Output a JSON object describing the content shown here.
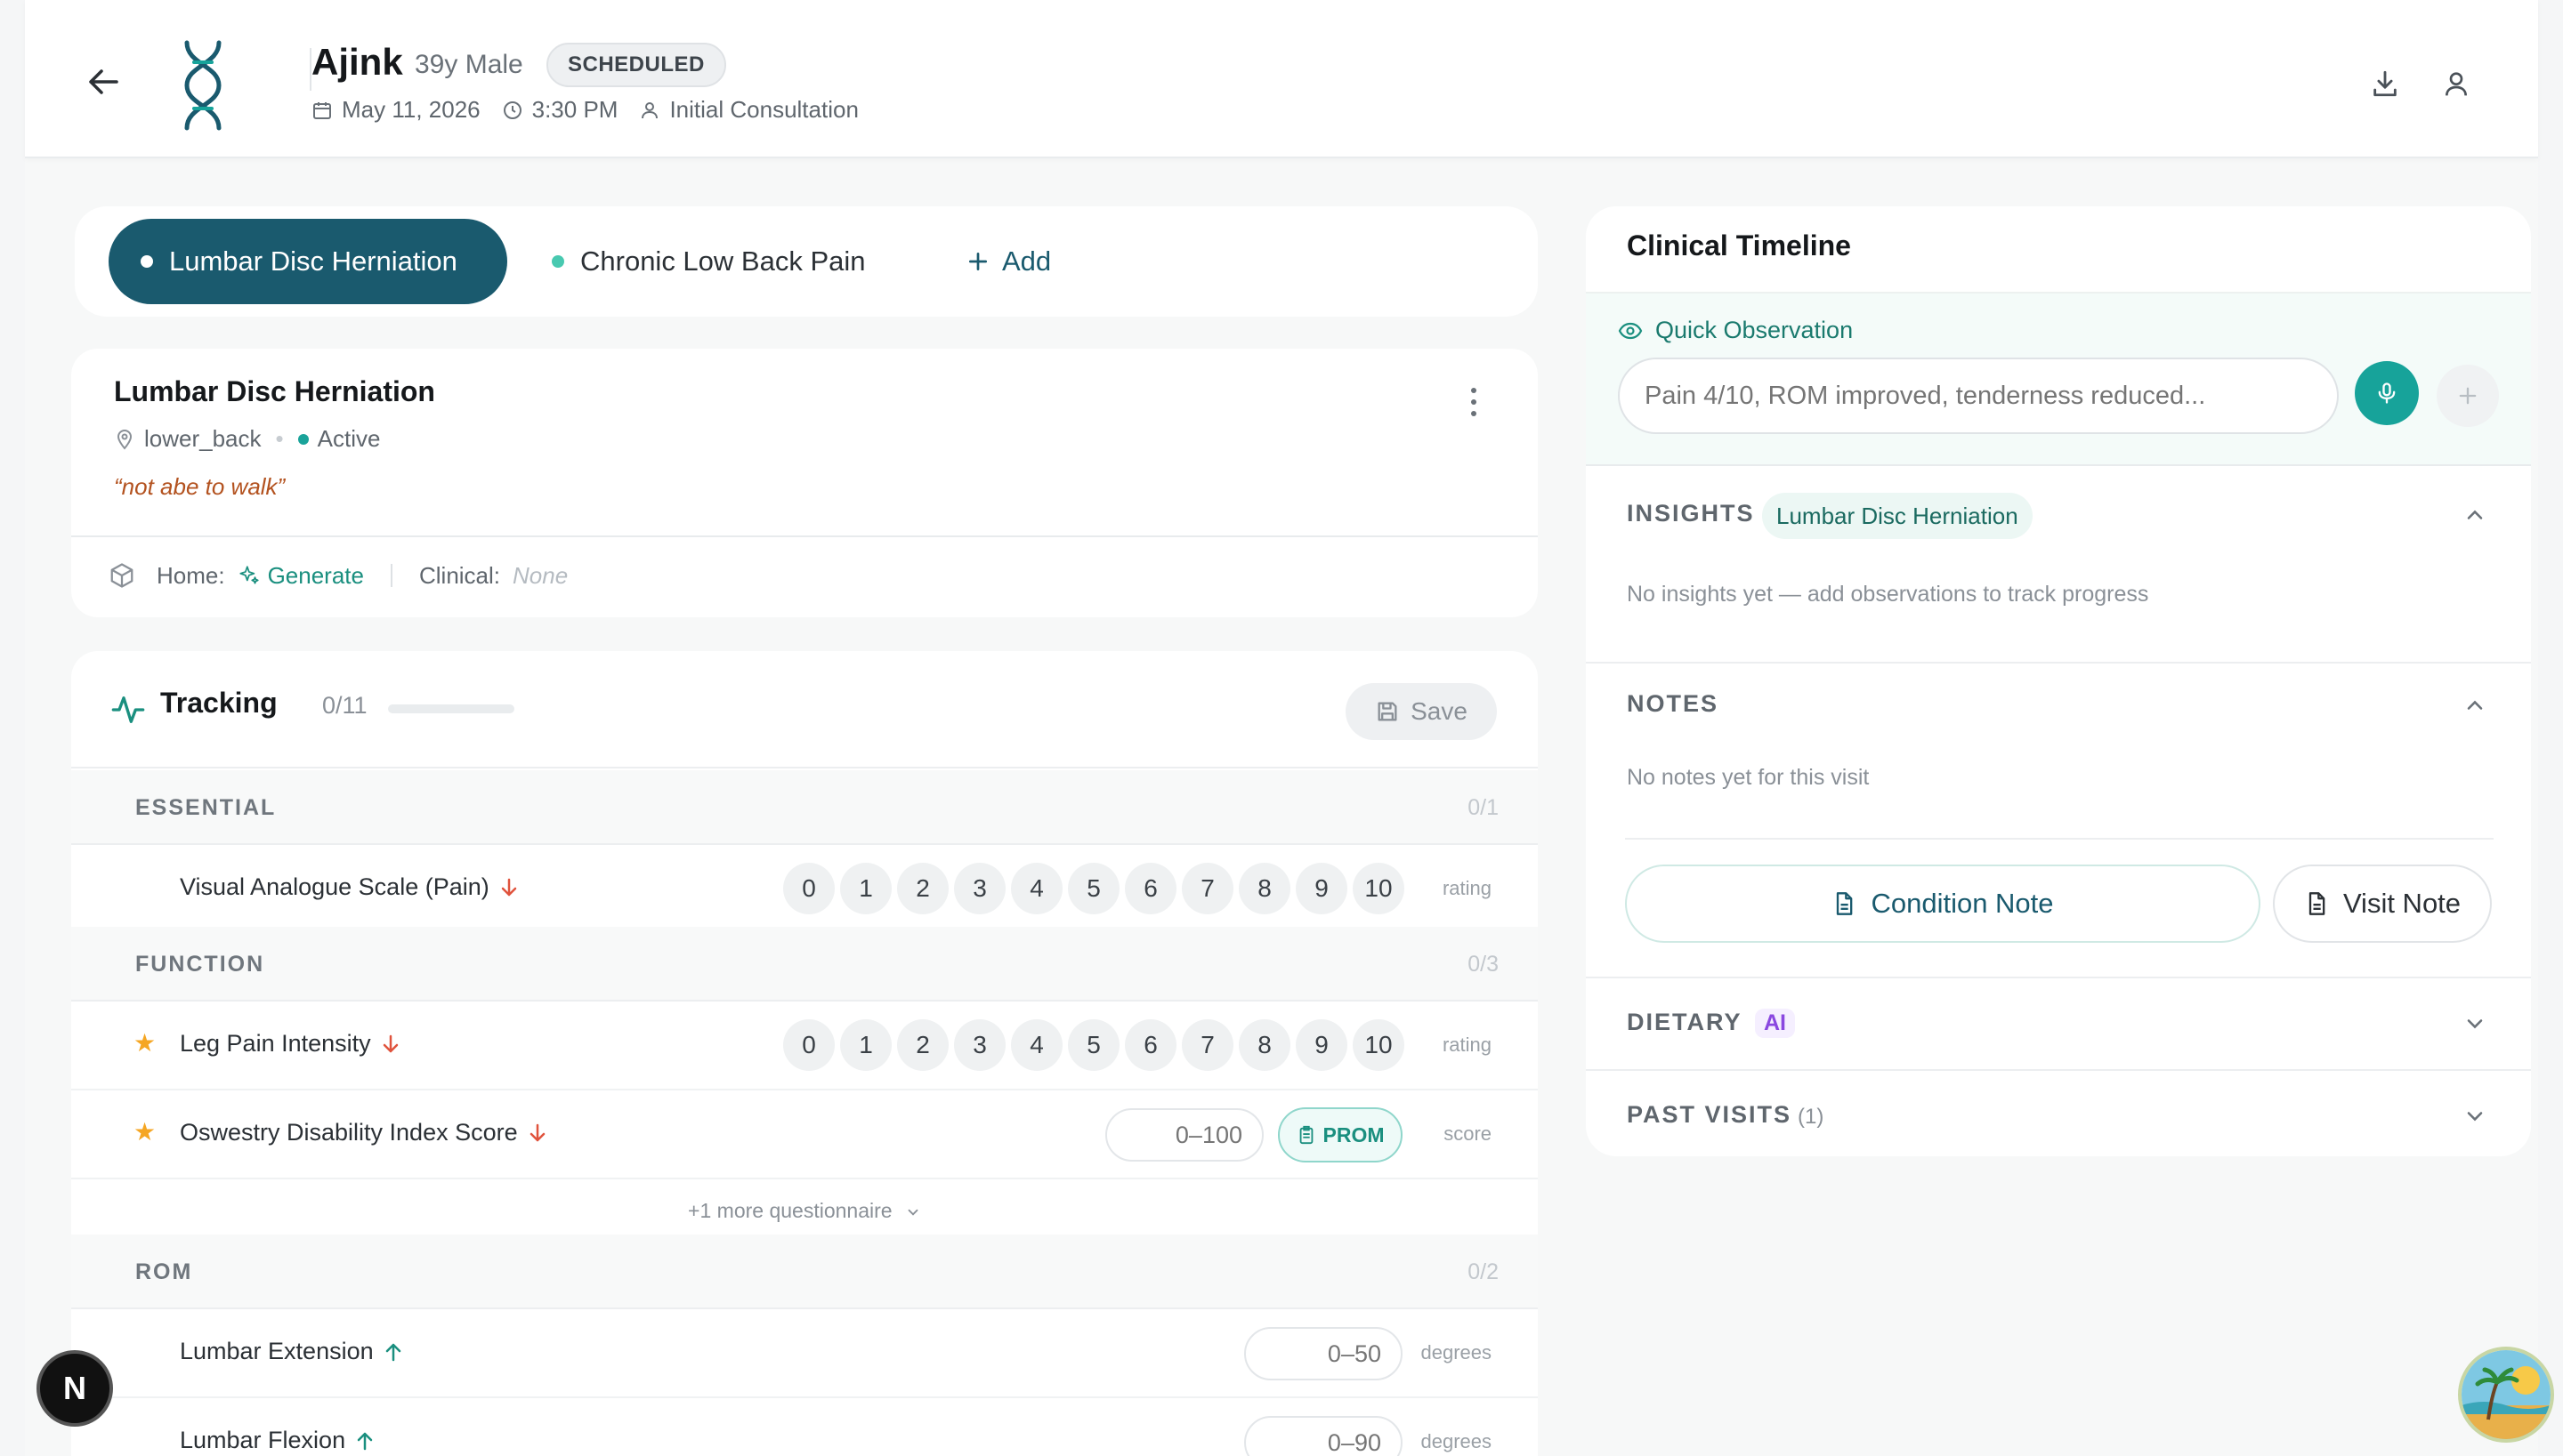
{
  "header": {
    "patient_name": "Ajink",
    "patient_meta": "39y Male",
    "status_badge": "SCHEDULED",
    "date": "May 11, 2026",
    "time": "3:30 PM",
    "visit_type": "Initial Consultation"
  },
  "condition_tabs": {
    "active": "Lumbar Disc Herniation",
    "inactive": "Chronic Low Back Pain",
    "add_label": "Add"
  },
  "condition_card": {
    "title": "Lumbar Disc Herniation",
    "location": "lower_back",
    "status": "Active",
    "quote": "“not abe to walk”",
    "home_label": "Home:",
    "generate_label": "Generate",
    "clinical_label": "Clinical:",
    "clinical_value": "None"
  },
  "tracking": {
    "title": "Tracking",
    "count": "0/11",
    "progress": 0,
    "save_label": "Save",
    "sections": {
      "essential": {
        "label": "ESSENTIAL",
        "count": "0/1"
      },
      "function": {
        "label": "FUNCTION",
        "count": "0/3"
      },
      "rom": {
        "label": "ROM",
        "count": "0/2"
      }
    },
    "metrics": {
      "vas": {
        "name": "Visual Analogue Scale (Pain)",
        "unit": "rating"
      },
      "leg_pain": {
        "name": "Leg Pain Intensity",
        "unit": "rating"
      },
      "odi": {
        "name": "Oswestry Disability Index Score",
        "placeholder": "0–100",
        "prom_label": "PROM",
        "unit": "score"
      },
      "more": "+1 more questionnaire",
      "lumbar_ext": {
        "name": "Lumbar Extension",
        "placeholder": "0–50",
        "unit": "degrees"
      },
      "lumbar_flex": {
        "name": "Lumbar Flexion",
        "placeholder": "0–90",
        "unit": "degrees"
      }
    },
    "scale": [
      "0",
      "1",
      "2",
      "3",
      "4",
      "5",
      "6",
      "7",
      "8",
      "9",
      "10"
    ]
  },
  "timeline": {
    "title": "Clinical Timeline",
    "quick_obs_label": "Quick Observation",
    "quick_obs_placeholder": "Pain 4/10, ROM improved, tenderness reduced...",
    "insights_label": "INSIGHTS",
    "insights_pill": "Lumbar Disc Herniation",
    "insights_empty": "No insights yet — add observations to track progress",
    "notes_label": "NOTES",
    "notes_empty": "No notes yet for this visit",
    "condition_note_label": "Condition Note",
    "visit_note_label": "Visit Note",
    "dietary_label": "DIETARY",
    "dietary_tag": "AI",
    "past_visits_label": "PAST VISITS",
    "past_visits_count": "(1)"
  },
  "floating": {
    "n_badge": "N"
  },
  "colors": {
    "primary": "#1a5a6e",
    "accent": "#17a39a",
    "warning": "#f5a623",
    "quote": "#b3521f"
  },
  "icons": [
    "arrow-left-icon",
    "helix-logo-icon",
    "calendar-icon",
    "clock-icon",
    "user-icon",
    "download-icon",
    "profile-icon",
    "map-pin-icon",
    "box-icon",
    "sparkle-icon",
    "activity-icon",
    "save-icon",
    "arrow-down-icon",
    "arrow-up-icon",
    "star-icon",
    "clipboard-icon",
    "chevron-down-icon",
    "chevron-up-icon",
    "eye-icon",
    "mic-icon",
    "plus-icon",
    "document-icon"
  ]
}
